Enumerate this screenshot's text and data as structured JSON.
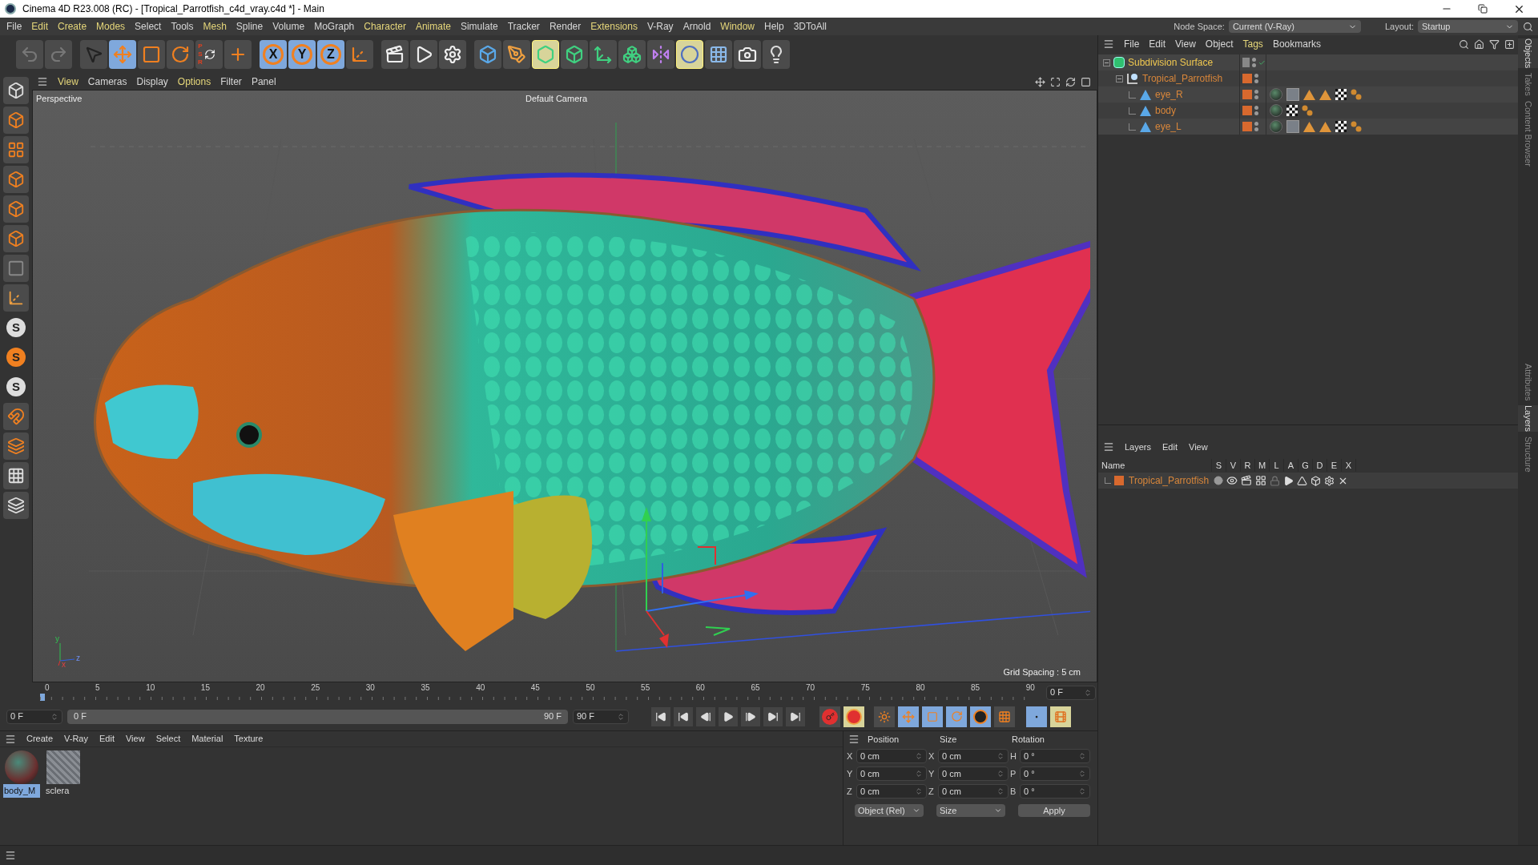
{
  "window": {
    "title": "Cinema 4D R23.008 (RC) - [Tropical_Parrotfish_c4d_vray.c4d *] - Main"
  },
  "menu": [
    {
      "label": "File",
      "color": "#d8d8d8"
    },
    {
      "label": "Edit",
      "color": "#e6d77a"
    },
    {
      "label": "Create",
      "color": "#e6d77a"
    },
    {
      "label": "Modes",
      "color": "#e6d77a"
    },
    {
      "label": "Select",
      "color": "#d8d8d8"
    },
    {
      "label": "Tools",
      "color": "#d8d8d8"
    },
    {
      "label": "Mesh",
      "color": "#e6d77a"
    },
    {
      "label": "Spline",
      "color": "#d8d8d8"
    },
    {
      "label": "Volume",
      "color": "#d8d8d8"
    },
    {
      "label": "MoGraph",
      "color": "#d8d8d8"
    },
    {
      "label": "Character",
      "color": "#e6d77a"
    },
    {
      "label": "Animate",
      "color": "#e6d77a"
    },
    {
      "label": "Simulate",
      "color": "#d8d8d8"
    },
    {
      "label": "Tracker",
      "color": "#d8d8d8"
    },
    {
      "label": "Render",
      "color": "#d8d8d8"
    },
    {
      "label": "Extensions",
      "color": "#e6d77a"
    },
    {
      "label": "V-Ray",
      "color": "#d8d8d8"
    },
    {
      "label": "Arnold",
      "color": "#d8d8d8"
    },
    {
      "label": "Window",
      "color": "#e6d77a"
    },
    {
      "label": "Help",
      "color": "#d8d8d8"
    },
    {
      "label": "3DToAll",
      "color": "#d8d8d8"
    }
  ],
  "node_space": {
    "label": "Node Space:",
    "value": "Current (V-Ray)"
  },
  "layout": {
    "label": "Layout:",
    "value": "Startup"
  },
  "toolbar": [
    [
      {
        "kind": "undo",
        "active": false,
        "pinned": false
      },
      {
        "kind": "redo",
        "active": false,
        "pinned": false
      }
    ],
    [
      {
        "kind": "select",
        "active": false,
        "pinned": false
      },
      {
        "kind": "move",
        "active": true,
        "pinned": false
      },
      {
        "kind": "scale",
        "active": false,
        "pinned": false
      },
      {
        "kind": "rotate",
        "active": false,
        "pinned": false
      },
      {
        "kind": "psr",
        "label": "PSR",
        "active": false,
        "pinned": false
      },
      {
        "kind": "add",
        "active": false,
        "pinned": false
      }
    ],
    [
      {
        "kind": "axis",
        "label": "X",
        "active": true,
        "pinned": false
      },
      {
        "kind": "axis",
        "label": "Y",
        "active": true,
        "pinned": false
      },
      {
        "kind": "axis",
        "label": "Z",
        "active": true,
        "pinned": false
      },
      {
        "kind": "coords",
        "active": false,
        "pinned": false
      }
    ],
    [
      {
        "kind": "render-view",
        "active": false,
        "pinned": false
      },
      {
        "kind": "render",
        "active": false,
        "pinned": false
      },
      {
        "kind": "render-settings",
        "active": false,
        "pinned": false
      }
    ],
    [
      {
        "kind": "cube",
        "active": false,
        "pinned": false
      },
      {
        "kind": "pen",
        "active": false,
        "pinned": false
      },
      {
        "kind": "subdivision",
        "active": false,
        "pinned": true
      },
      {
        "kind": "extrude",
        "active": false,
        "pinned": false
      },
      {
        "kind": "cloner",
        "active": false,
        "pinned": false
      },
      {
        "kind": "boxes",
        "active": false,
        "pinned": false
      },
      {
        "kind": "symmetry",
        "active": false,
        "pinned": false
      },
      {
        "kind": "deformer",
        "active": false,
        "pinned": true
      },
      {
        "kind": "floor",
        "active": false,
        "pinned": false
      },
      {
        "kind": "camera",
        "active": false,
        "pinned": false
      },
      {
        "kind": "light",
        "active": false,
        "pinned": false
      }
    ]
  ],
  "left_toolbar": [
    {
      "kind": "model"
    },
    {
      "kind": "cube"
    },
    {
      "kind": "checker"
    },
    {
      "kind": "points"
    },
    {
      "kind": "edges"
    },
    {
      "kind": "polygons"
    },
    {
      "kind": "uv"
    },
    {
      "kind": "axis"
    },
    {
      "kind": "snap",
      "label": "S"
    },
    {
      "kind": "snap-orange",
      "label": "S"
    },
    {
      "kind": "snap",
      "label": "S"
    },
    {
      "kind": "magnet"
    },
    {
      "kind": "plane"
    },
    {
      "kind": "grid"
    },
    {
      "kind": "workplane"
    }
  ],
  "viewport": {
    "menu": [
      {
        "label": "View",
        "color": "#e6d77a"
      },
      {
        "label": "Cameras",
        "color": "#d8d8d8"
      },
      {
        "label": "Display",
        "color": "#d8d8d8"
      },
      {
        "label": "Options",
        "color": "#e6d77a"
      },
      {
        "label": "Filter",
        "color": "#d8d8d8"
      },
      {
        "label": "Panel",
        "color": "#d8d8d8"
      }
    ],
    "view_name": "Perspective",
    "camera": "Default Camera",
    "grid_spacing": "Grid Spacing : 5 cm",
    "axis_labels": [
      "y",
      "z",
      "x"
    ]
  },
  "timeline": {
    "ticks": [
      "0",
      "5",
      "10",
      "15",
      "20",
      "25",
      "30",
      "35",
      "40",
      "45",
      "50",
      "55",
      "60",
      "65",
      "70",
      "75",
      "80",
      "85",
      "90"
    ],
    "current_frame": "0 F",
    "start_field": "0 F",
    "preview_range": {
      "start": "0 F",
      "end": "90 F",
      "level": 1
    },
    "end_field": "90 F"
  },
  "transport": [
    {
      "kind": "first"
    },
    {
      "kind": "prev-key"
    },
    {
      "kind": "prev"
    },
    {
      "kind": "play"
    },
    {
      "kind": "next"
    },
    {
      "kind": "next-key"
    },
    {
      "kind": "last"
    }
  ],
  "material_menu": [
    "Create",
    "V-Ray",
    "Edit",
    "View",
    "Select",
    "Material",
    "Texture"
  ],
  "materials": [
    {
      "name": "body_M",
      "kind": "sphere",
      "selected": true
    },
    {
      "name": "sclera",
      "kind": "grid",
      "selected": false
    }
  ],
  "coordinates": {
    "headers": [
      "Position",
      "Size",
      "Rotation"
    ],
    "rows": [
      {
        "pos_axis": "X",
        "position": "0 cm",
        "size_axis": "X",
        "size": "0 cm",
        "rot_axis": "H",
        "rotation": "0 °"
      },
      {
        "pos_axis": "Y",
        "position": "0 cm",
        "size_axis": "Y",
        "size": "0 cm",
        "rot_axis": "P",
        "rotation": "0 °"
      },
      {
        "pos_axis": "Z",
        "position": "0 cm",
        "size_axis": "Z",
        "size": "0 cm",
        "rot_axis": "B",
        "rotation": "0 °"
      }
    ],
    "mode": "Object (Rel)",
    "size_mode": "Size",
    "apply": "Apply"
  },
  "objects_menu": [
    {
      "label": "File",
      "color": "#d8d8d8"
    },
    {
      "label": "Edit",
      "color": "#d8d8d8"
    },
    {
      "label": "View",
      "color": "#d8d8d8"
    },
    {
      "label": "Object",
      "color": "#d8d8d8"
    },
    {
      "label": "Tags",
      "color": "#e6d77a"
    },
    {
      "label": "Bookmarks",
      "color": "#d8d8d8"
    }
  ],
  "objects": [
    {
      "name": "Subdivision Surface",
      "kind": "subdivision",
      "expanded": true,
      "enabled": true,
      "children": [
        {
          "name": "Tropical_Parrotfish",
          "kind": "null",
          "expanded": true,
          "color": "#d8692e",
          "children": [
            {
              "name": "eye_R",
              "kind": "polygon",
              "color": "#d8692e",
              "tags": [
                {
                  "kind": "material"
                },
                {
                  "kind": "texture"
                },
                {
                  "kind": "triangle"
                },
                {
                  "kind": "triangle"
                },
                {
                  "kind": "checker"
                },
                {
                  "kind": "dots"
                }
              ]
            },
            {
              "name": "body",
              "kind": "polygon",
              "color": "#d8692e",
              "tags": [
                {
                  "kind": "material"
                },
                {
                  "kind": "checker"
                },
                {
                  "kind": "dots"
                }
              ]
            },
            {
              "name": "eye_L",
              "kind": "polygon",
              "color": "#d8692e",
              "tags": [
                {
                  "kind": "material"
                },
                {
                  "kind": "texture"
                },
                {
                  "kind": "triangle"
                },
                {
                  "kind": "triangle"
                },
                {
                  "kind": "checker"
                },
                {
                  "kind": "dots"
                }
              ]
            }
          ]
        }
      ]
    }
  ],
  "layers_menu": [
    "Layers",
    "Edit",
    "View"
  ],
  "layers_columns": [
    "Name",
    "S",
    "V",
    "R",
    "M",
    "L",
    "A",
    "G",
    "D",
    "E",
    "X"
  ],
  "layers": [
    {
      "name": "Tropical_Parrotfish",
      "color": "#d8692e"
    }
  ],
  "side_tabs": [
    "Objects",
    "Takes",
    "Content Browser",
    "Attributes",
    "Layers",
    "Structure"
  ]
}
